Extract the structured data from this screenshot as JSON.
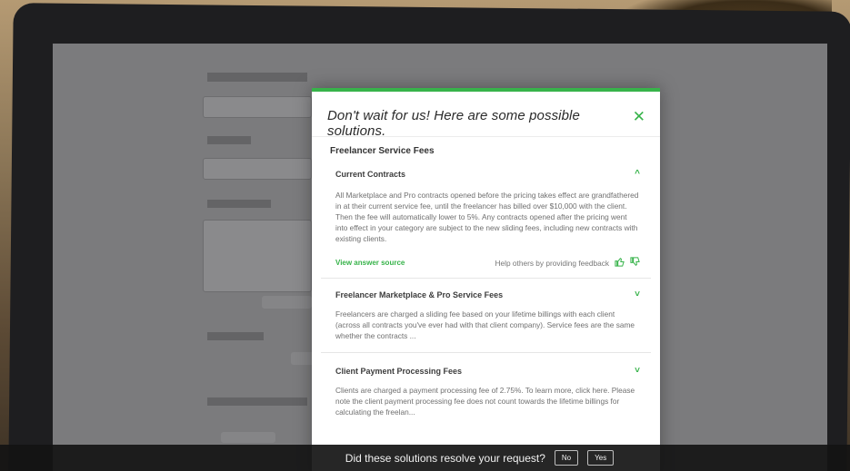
{
  "modal": {
    "title": "Don't wait for us! Here are some possible solutions.",
    "close_icon": "close-icon",
    "section_title": "Freelancer Service Fees",
    "faqs": [
      {
        "title": "Current Contracts",
        "chevron": "^",
        "body": "All Marketplace and Pro contracts opened before the pricing takes effect are grandfathered in at their current service fee, until the freelancer has billed over $10,000 with the client. Then the fee will automatically lower to 5%. Any contracts opened after the pricing went into effect in your category are subject to the new sliding fees, including new contracts with existing clients.",
        "source_link": "View answer source",
        "feedback_text": "Help others by providing feedback"
      },
      {
        "title": "Freelancer Marketplace & Pro Service Fees",
        "chevron": "˅",
        "body": "Freelancers are charged a sliding fee based on your lifetime billings with each client (across all contracts you've ever had with that client company). Service fees are the same whether the contracts ..."
      },
      {
        "title": "Client Payment Processing Fees",
        "chevron": "˅",
        "body": "Clients are charged a payment processing fee of 2.75%. To learn more, click here. Please note the client payment processing fee does not count towards the lifetime billings for calculating the freelan..."
      }
    ]
  },
  "resolve_bar": {
    "question": "Did these solutions resolve your request?",
    "no_label": "No",
    "yes_label": "Yes"
  },
  "colors": {
    "accent": "#37b34a",
    "overlay": "#7b7b7d",
    "bar": "#141414"
  }
}
